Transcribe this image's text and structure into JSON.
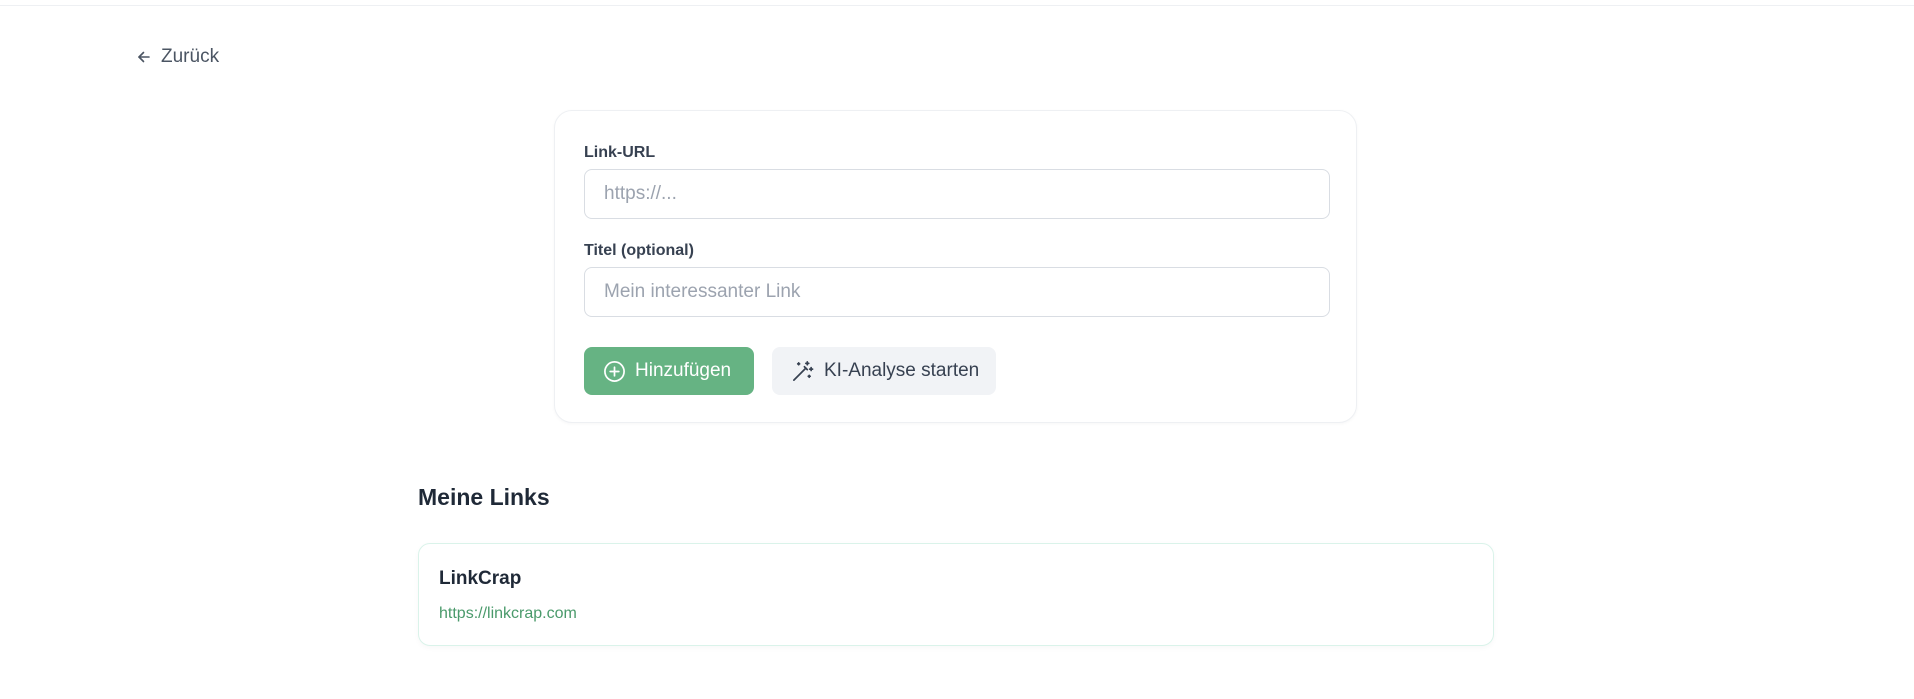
{
  "nav": {
    "back_label": "Zurück",
    "back_icon": "arrow-left-icon"
  },
  "form": {
    "url_label": "Link-URL",
    "url_value": "",
    "url_placeholder": "https://...",
    "title_label": "Titel (optional)",
    "title_value": "",
    "title_placeholder": "Mein interessanter Link",
    "add_button_label": "Hinzufügen",
    "add_button_icon": "plus-circle-icon",
    "ai_button_label": "KI-Analyse starten",
    "ai_button_icon": "magic-wand-icon"
  },
  "links_section": {
    "title": "Meine Links",
    "items": [
      {
        "title": "LinkCrap",
        "url": "https://linkcrap.com"
      }
    ]
  },
  "colors": {
    "accent": "#66b383",
    "link": "#4a9a6b",
    "secondary_button": "#f1f3f6"
  }
}
